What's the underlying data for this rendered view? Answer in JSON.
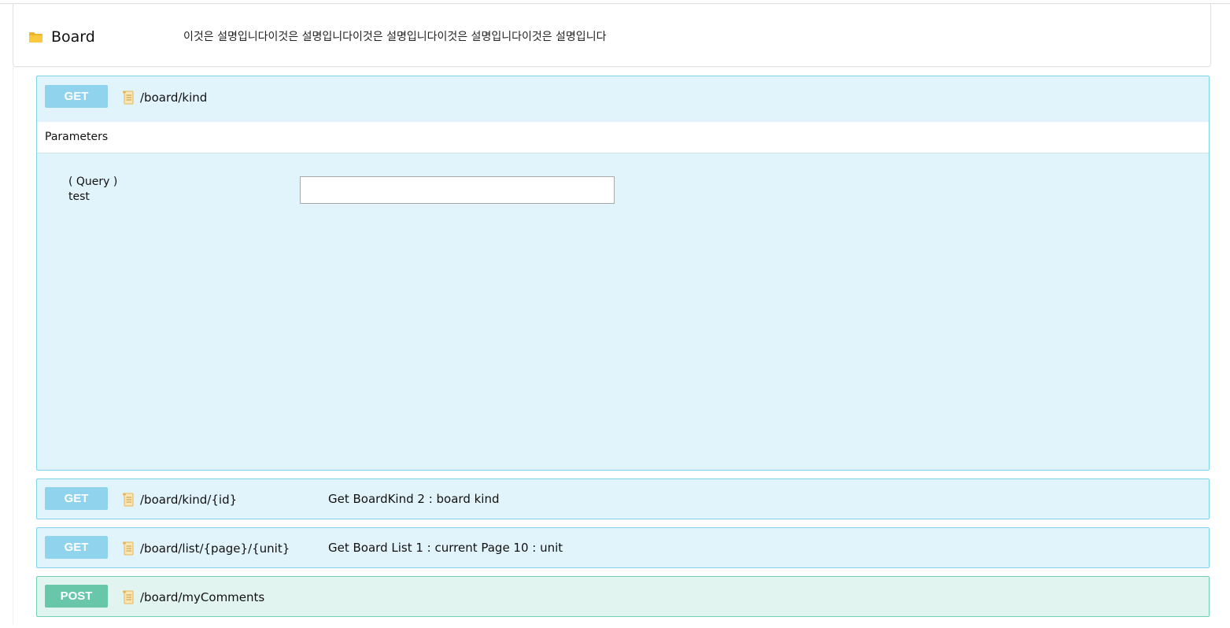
{
  "group": {
    "title": "Board",
    "description": "이것은 설명입니다이것은 설명입니다이것은 설명입니다이것은 설명입니다이것은 설명입니다",
    "icon": "folder-icon"
  },
  "colors": {
    "get_border": "#7fd3e8",
    "get_background": "#e2f4fb",
    "get_method": "#8fd4ec",
    "post_border": "#6fd0b4",
    "post_background": "#e1f4ef",
    "post_method": "#68c6a9"
  },
  "operations": [
    {
      "method": "GET",
      "path": "/board/kind",
      "summary": "",
      "expanded": true,
      "parameters_label": "Parameters",
      "parameters": [
        {
          "location": "( Query )",
          "name": "test",
          "value": ""
        }
      ]
    },
    {
      "method": "GET",
      "path": "/board/kind/{id}",
      "summary": "Get BoardKind 2 : board kind"
    },
    {
      "method": "GET",
      "path": "/board/list/{page}/{unit}",
      "summary": "Get Board List 1 : current Page 10 : unit"
    },
    {
      "method": "POST",
      "path": "/board/myComments",
      "summary": ""
    }
  ]
}
